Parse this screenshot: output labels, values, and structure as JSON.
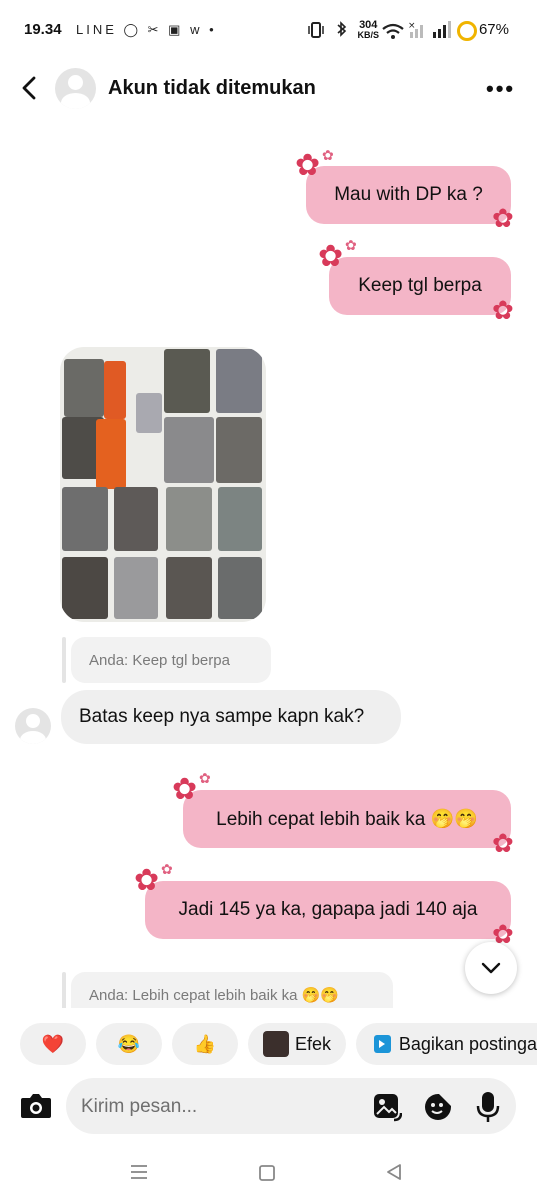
{
  "status_bar": {
    "time": "19.34",
    "app_icons": "LINE ◯ ✂ ▣ w •",
    "net_speed_value": "304",
    "net_speed_unit": "KB/S",
    "battery": "67%"
  },
  "header": {
    "title": "Akun tidak ditemukan"
  },
  "messages": [
    {
      "type": "outgoing",
      "text": "Mau with DP ka ?"
    },
    {
      "type": "outgoing",
      "text": "Keep tgl berpa"
    },
    {
      "type": "incoming-reply",
      "text": "Anda: Keep tgl berpa"
    },
    {
      "type": "incoming",
      "text": "Batas keep nya sampe kapn kak?"
    },
    {
      "type": "outgoing",
      "text": "Lebih cepat lebih baik ka 🤭🤭"
    },
    {
      "type": "outgoing",
      "text": "Jadi 145 ya ka, gapapa jadi 140 aja"
    },
    {
      "type": "incoming-reply",
      "text": "Anda: Lebih cepat lebih baik ka 🤭🤭"
    }
  ],
  "quick_replies": {
    "heart": "❤️",
    "laugh": "😂",
    "thumbs": "👍",
    "effect_label": "Efek",
    "share_label": "Bagikan postinga"
  },
  "composer": {
    "placeholder": "Kirim pesan..."
  },
  "colors": {
    "outgoing_bubble": "#f4b5c7",
    "incoming_bubble": "#efefef",
    "flower": "#d83a5a"
  }
}
